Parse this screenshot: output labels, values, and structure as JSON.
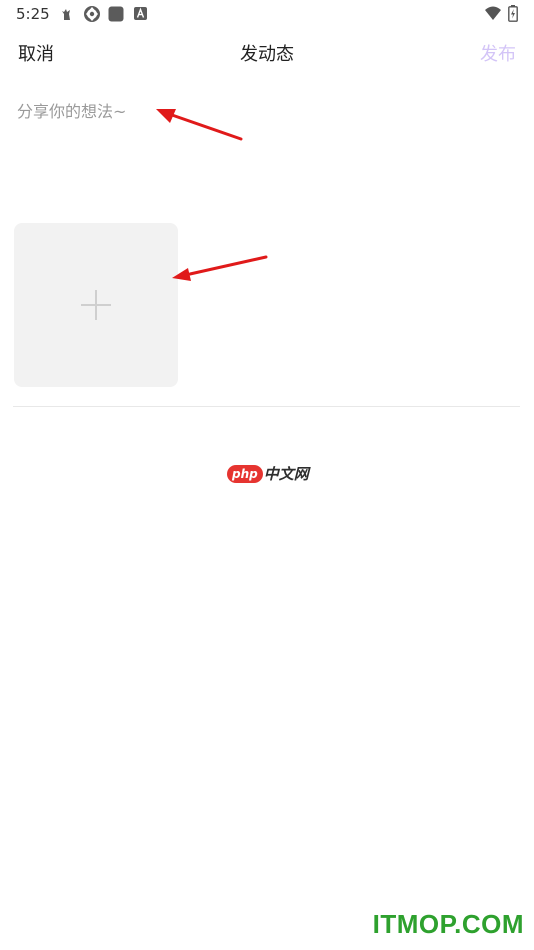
{
  "status_bar": {
    "time": "5:25",
    "icons_left": [
      "bug-icon",
      "sync-icon",
      "square-app-icon",
      "a-badge-icon"
    ],
    "icons_right": [
      "wifi-icon",
      "battery-icon"
    ]
  },
  "nav": {
    "cancel_label": "取消",
    "title": "发动态",
    "publish_label": "发布",
    "publish_color": "#d3c4f7"
  },
  "compose": {
    "placeholder": "分享你的想法~",
    "value": ""
  },
  "image_picker": {
    "add_icon": "plus-icon"
  },
  "logo": {
    "badge": "php",
    "text": "中文网"
  },
  "watermark": {
    "text": "ITMOP.COM",
    "color": "#2ea12e"
  },
  "annotation": {
    "arrow_color": "#e01a1a"
  }
}
